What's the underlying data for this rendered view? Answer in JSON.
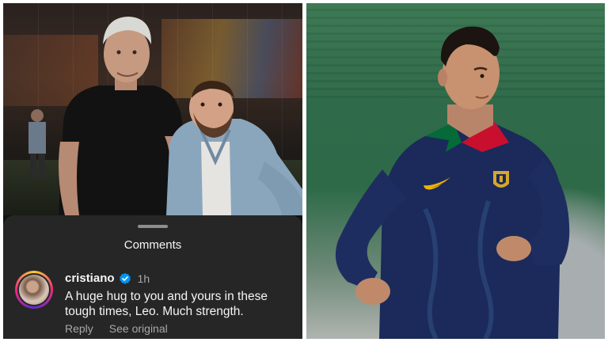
{
  "sheet": {
    "title": "Comments"
  },
  "comment": {
    "username": "cristiano",
    "verified": true,
    "time": "1h",
    "text": "A huge hug to you and yours in these tough times, Leo. Much strength.",
    "reply_label": "Reply",
    "see_original_label": "See original"
  },
  "colors": {
    "sheet_bg": "#262626",
    "verified_blue": "#0095f6",
    "jersey_navy": "#1b2a5a",
    "portugal_red": "#c8102e",
    "portugal_green": "#046a38"
  },
  "icons": {
    "verified": "verified-badge-icon",
    "crest": "portugal-crest-icon",
    "swoosh": "nike-swoosh-icon"
  }
}
